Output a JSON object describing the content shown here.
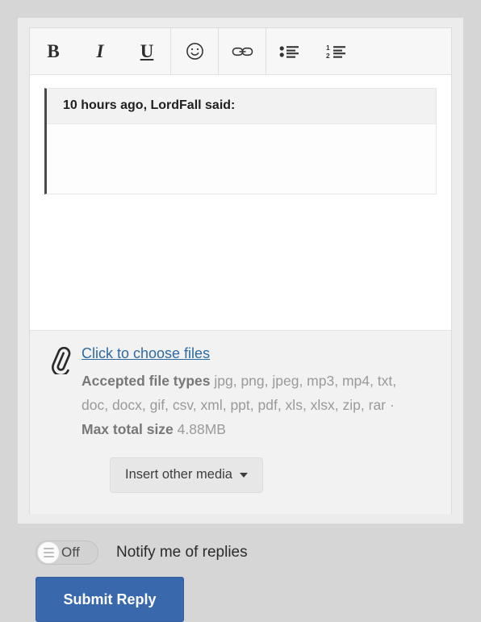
{
  "toolbar": {
    "buttons": [
      {
        "name": "bold",
        "label": "B"
      },
      {
        "name": "italic",
        "label": "I"
      },
      {
        "name": "underline",
        "label": "U"
      },
      {
        "name": "emoticon",
        "label": "smiley-icon"
      },
      {
        "name": "link",
        "label": "link-icon"
      },
      {
        "name": "bullet-list",
        "label": "bullet-list-icon"
      },
      {
        "name": "numbered-list",
        "label": "numbered-list-icon"
      }
    ],
    "list_numbers": {
      "first": "1",
      "second": "2"
    }
  },
  "editor": {
    "quote": {
      "header": "10 hours ago, LordFall said:",
      "body": ""
    }
  },
  "attachments": {
    "icon": "paperclip-icon",
    "choose_link": "Click to choose files",
    "accepted_label": "Accepted file types",
    "accepted_values": "jpg, png, jpeg, mp3, mp4, txt, doc, docx, gif, csv, xml, ppt, pdf, xls, xlsx, zip, rar",
    "separator": "·",
    "max_size_label": "Max total size",
    "max_size_value": "4.88MB",
    "media_button": "Insert other media"
  },
  "footer": {
    "toggle_state": "Off",
    "notify_label": "Notify me of replies",
    "submit_label": "Submit Reply"
  },
  "colors": {
    "accent": "#3a68ad",
    "link": "#2d6a9f",
    "page_bg": "#d6d6d6",
    "panel_bg": "#ececec",
    "toolbar_bg": "#f7f7f7",
    "attach_bg": "#f2f2f2",
    "quote_border": "#4a4a4a"
  }
}
